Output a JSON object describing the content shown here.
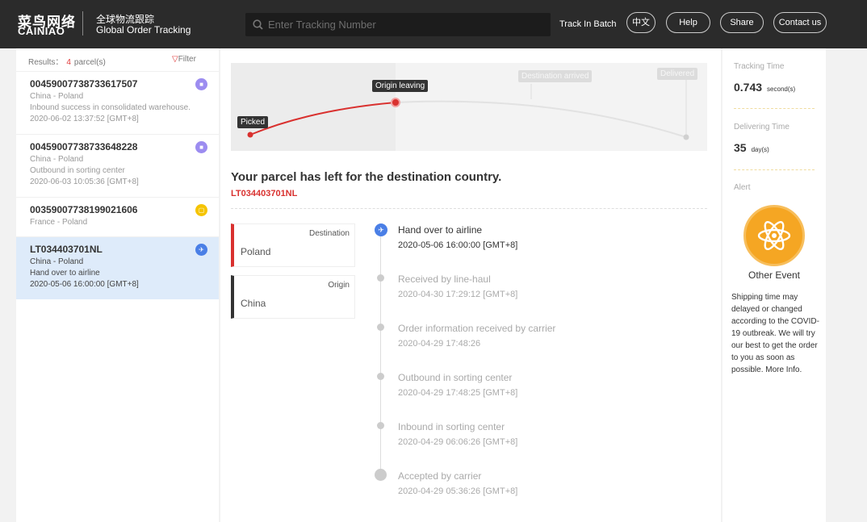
{
  "header": {
    "logo_cn": "菜鸟网络",
    "logo_en": "CAINIAO",
    "sub_cn": "全球物流跟踪",
    "sub_en": "Global Order Tracking",
    "search_placeholder": "Enter Tracking Number",
    "batch": "Track In Batch",
    "buttons": [
      "中文",
      "Help",
      "Share",
      "Contact us"
    ]
  },
  "sidebar": {
    "results_label": "Results：",
    "count": "4",
    "count_unit": "parcel(s)",
    "filter": "Filter",
    "items": [
      {
        "number": "00459007738733617507",
        "route": "China - Poland",
        "status": "Inbound success in consolidated warehouse.",
        "time": "2020-06-02 13:37:52 [GMT+8]",
        "icon": "truck-icon",
        "color": "#9c8cf0"
      },
      {
        "number": "00459007738733648228",
        "route": "China - Poland",
        "status": "Outbound in sorting center",
        "time": "2020-06-03 10:05:36 [GMT+8]",
        "icon": "truck-icon",
        "color": "#9c8cf0"
      },
      {
        "number": "00359007738199021606",
        "route": "France - Poland",
        "icon": "box-icon",
        "color": "#f5c400"
      },
      {
        "number": "LT034403701NL",
        "route": "China - Poland",
        "status": "Hand over to airline",
        "time": "2020-05-06 16:00:00 [GMT+8]",
        "icon": "plane-icon",
        "color": "#4a7fe6"
      }
    ]
  },
  "map": {
    "stages": [
      "Picked",
      "Origin leaving",
      "Destination arrived",
      "Delivered"
    ],
    "progress_stage": 2,
    "accent": "#d9312f"
  },
  "main": {
    "title": "Your parcel has left for the destination country.",
    "tracking_number": "LT034403701NL",
    "destination_label": "Destination",
    "destination": "Poland",
    "origin_label": "Origin",
    "origin": "China",
    "events": [
      {
        "desc": "Hand over to airline",
        "time": "2020-05-06 16:00:00 [GMT+8]"
      },
      {
        "desc": "Received by line-haul",
        "time": "2020-04-30 17:29:12 [GMT+8]"
      },
      {
        "desc": "Order information received by carrier",
        "time": "2020-04-29 17:48:26"
      },
      {
        "desc": "Outbound in sorting center",
        "time": "2020-04-29 17:48:25 [GMT+8]"
      },
      {
        "desc": "Inbound in sorting center",
        "time": "2020-04-29 06:06:26 [GMT+8]"
      },
      {
        "desc": "Accepted by carrier",
        "time": "2020-04-29 05:36:26 [GMT+8]"
      }
    ]
  },
  "right": {
    "tracking_label": "Tracking Time",
    "tracking_value": "0.743",
    "tracking_unit": "second(s)",
    "delivering_label": "Delivering Time",
    "delivering_value": "35",
    "delivering_unit": "day(s)",
    "alert_label": "Alert",
    "alert_title": "Other Event",
    "alert_text": "Shipping time may delayed or changed according to the COVID-19 outbreak. We will try our best to get the order to you as soon as possible.",
    "more": "More Info."
  }
}
